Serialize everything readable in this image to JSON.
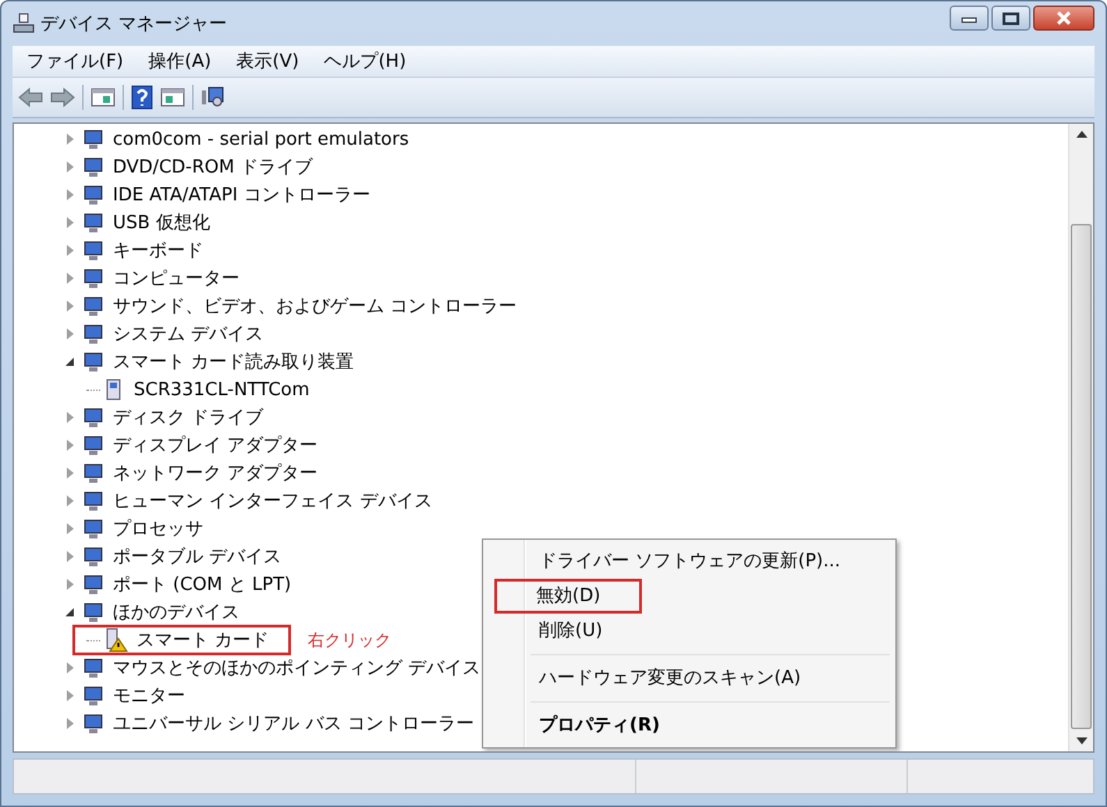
{
  "window": {
    "title": "デバイス マネージャー"
  },
  "menu": [
    {
      "label": "ファイル(F)"
    },
    {
      "label": "操作(A)"
    },
    {
      "label": "表示(V)"
    },
    {
      "label": "ヘルプ(H)"
    }
  ],
  "tree": [
    {
      "label": "com0com - serial port emulators",
      "expanded": false
    },
    {
      "label": "DVD/CD-ROM ドライブ",
      "expanded": false
    },
    {
      "label": "IDE ATA/ATAPI コントローラー",
      "expanded": false
    },
    {
      "label": "USB 仮想化",
      "expanded": false
    },
    {
      "label": "キーボード",
      "expanded": false
    },
    {
      "label": "コンピューター",
      "expanded": false
    },
    {
      "label": "サウンド、ビデオ、およびゲーム コントローラー",
      "expanded": false
    },
    {
      "label": "システム デバイス",
      "expanded": false
    },
    {
      "label": "スマート カード読み取り装置",
      "expanded": true,
      "children": [
        {
          "label": "SCR331CL-NTTCom",
          "warning": false,
          "highlighted": false
        }
      ]
    },
    {
      "label": "ディスク ドライブ",
      "expanded": false
    },
    {
      "label": "ディスプレイ アダプター",
      "expanded": false
    },
    {
      "label": "ネットワーク アダプター",
      "expanded": false
    },
    {
      "label": "ヒューマン インターフェイス デバイス",
      "expanded": false
    },
    {
      "label": "プロセッサ",
      "expanded": false
    },
    {
      "label": "ポータブル デバイス",
      "expanded": false
    },
    {
      "label": "ポート (COM と LPT)",
      "expanded": false
    },
    {
      "label": "ほかのデバイス",
      "expanded": true,
      "children": [
        {
          "label": "スマート カード",
          "warning": true,
          "highlighted": true
        }
      ]
    },
    {
      "label": "マウスとそのほかのポインティング デバイス",
      "expanded": false
    },
    {
      "label": "モニター",
      "expanded": false
    },
    {
      "label": "ユニバーサル シリアル バス コントローラー",
      "expanded": false
    }
  ],
  "callout": "右クリック",
  "context_menu": [
    {
      "label": "ドライバー ソフトウェアの更新(P)...",
      "bold": false,
      "highlighted": false,
      "separator_after": false
    },
    {
      "label": "無効(D)",
      "bold": false,
      "highlighted": true,
      "separator_after": false
    },
    {
      "label": "削除(U)",
      "bold": false,
      "highlighted": false,
      "separator_after": true
    },
    {
      "label": "ハードウェア変更のスキャン(A)",
      "bold": false,
      "highlighted": false,
      "separator_after": true
    },
    {
      "label": "プロパティ(R)",
      "bold": true,
      "highlighted": false,
      "separator_after": false
    }
  ]
}
